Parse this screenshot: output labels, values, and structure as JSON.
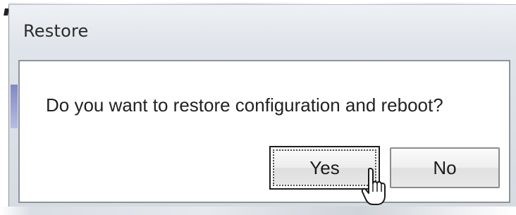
{
  "window": {
    "title": "Restore"
  },
  "dialog": {
    "message": "Do you want to restore configuration and reboot?",
    "buttons": {
      "yes_label": "Yes",
      "no_label": "No"
    }
  },
  "cursor": {
    "icon": "hand-pointer-cursor-icon"
  }
}
